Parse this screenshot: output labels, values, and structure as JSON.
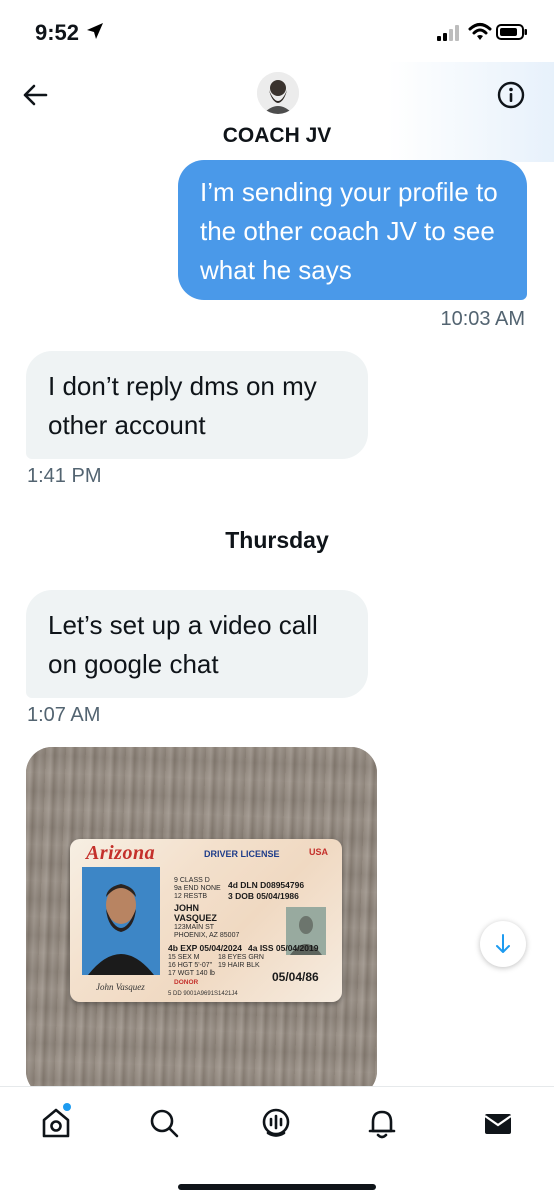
{
  "status_bar": {
    "time": "9:52"
  },
  "header": {
    "contact_name": "COACH JV",
    "back_icon": "arrow-left-icon",
    "info_icon": "info-circle-icon"
  },
  "messages": [
    {
      "direction": "sent",
      "text": "I’m sending your profile to the other coach JV to see what he says",
      "timestamp": "10:03 AM"
    },
    {
      "direction": "received",
      "text": "I don’t reply dms on my other account",
      "timestamp": "1:41 PM"
    },
    {
      "direction": "received",
      "text": "Let’s set up a video call on google chat",
      "timestamp": "1:07 AM"
    }
  ],
  "day_separator": "Thursday",
  "image_message": {
    "card": {
      "state": "Arizona",
      "type": "DRIVER LICENSE",
      "country": "USA",
      "class": "9 CLASS D",
      "end": "9a END  NONE",
      "rest": "12 RESTB",
      "first_name": "JOHN",
      "last_name": "VASQUEZ",
      "address1": "123MAIN ST",
      "address2": "PHOENIX, AZ 85007",
      "dln": "4d DLN D08954796",
      "dob": "3  DOB 05/04/1986",
      "exp": "4b EXP 05/04/2024",
      "iss": "4a ISS 05/04/2019",
      "sex": "15 SEX  M",
      "eyes": "18 EYES GRN",
      "hgt": "16 HGT  5'-07\"",
      "hair": "19 HAIR BLK",
      "wgt": "17 WGT  140 lb",
      "donor": "DONOR",
      "dob_short": "05/04/86",
      "signature": "John Vasquez",
      "dd": "5  DD 9001A9691S1421J4"
    }
  },
  "scroll_button": {
    "icon": "arrow-down-icon"
  },
  "tabbar": {
    "items": [
      {
        "icon": "home-icon",
        "active": true
      },
      {
        "icon": "search-icon"
      },
      {
        "icon": "spaces-icon"
      },
      {
        "icon": "bell-icon"
      },
      {
        "icon": "envelope-icon"
      }
    ]
  },
  "colors": {
    "sent_bubble": "#4a99e9",
    "received_bubble": "#eff3f4",
    "accent": "#1d9bf0"
  }
}
